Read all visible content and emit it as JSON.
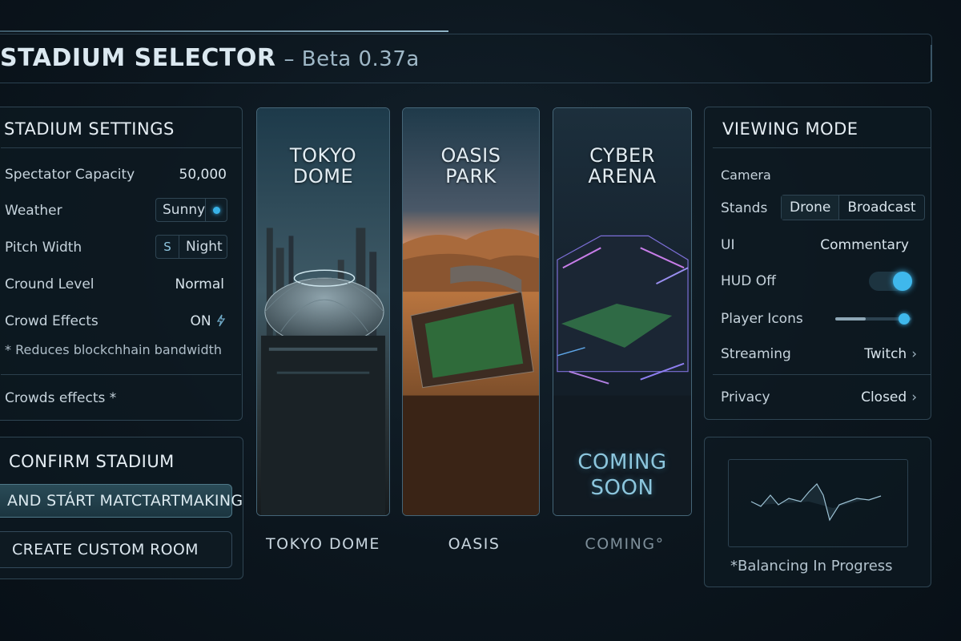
{
  "header": {
    "title": "STADIUM SELECTOR",
    "version": "– Beta 0.37a"
  },
  "settings": {
    "title": "STADIUM SETTINGS",
    "capacity_label": "Spectator Capacity",
    "capacity_value": "50,000",
    "weather_label": "Weather",
    "weather_value": "Sunny",
    "pitch_label": "Pitch Width",
    "pitch_chip_icon": "S",
    "pitch_value": "Night",
    "ground_label": "Cround Level",
    "ground_value": "Normal",
    "crowd_label": "Crowd Effects",
    "crowd_value": "ON",
    "note": "* Reduces blockchhain bandwidth",
    "crowds_footer": "Crowds effects *"
  },
  "actions": {
    "title": "CONFIRM STADIUM",
    "primary": "AND STÁRT MATCTARTMAKING",
    "secondary": "CREATE CUSTOM ROOM"
  },
  "stadiums": [
    {
      "title": "TOKYO\nDOME",
      "caption": "TOKYO DOME",
      "overlay": ""
    },
    {
      "title": "OASIS\nPARK",
      "caption": "OASIS",
      "overlay": ""
    },
    {
      "title": "CYBER\nARENA",
      "caption": "COMING°",
      "overlay": "COMING\nSOON"
    }
  ],
  "viewing": {
    "title": "VIEWING MODE",
    "camera_label": "Camera",
    "stands_label": "Stands",
    "stands_options": [
      "Drone",
      "Broadcast"
    ],
    "ui_label": "UI",
    "ui_value": "Commentary",
    "hud_label": "HUD Off",
    "hud_on": true,
    "player_icons_label": "Player Icons",
    "player_icons_level": 0.9,
    "streaming_label": "Streaming",
    "streaming_value": "Twitch",
    "privacy_label": "Privacy",
    "privacy_value": "Closed"
  },
  "balancing": {
    "caption": "*Balancing In Progress"
  },
  "colors": {
    "accent": "#3fb8ec",
    "panel_border": "#2f4553",
    "background": "#0c161e"
  }
}
